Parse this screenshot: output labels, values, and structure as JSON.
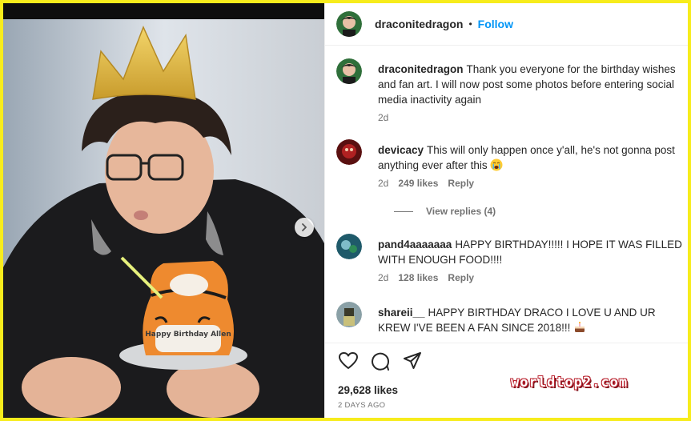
{
  "header": {
    "username": "draconitedragon",
    "separator": "•",
    "follow_label": "Follow"
  },
  "caption": {
    "username": "draconitedragon",
    "text": "Thank you everyone for the birthday wishes and fan art. I will now post some photos before entering social media inactivity again",
    "time": "2d"
  },
  "comments": [
    {
      "username": "devicacy",
      "text": "This will only happen once y'all, he's not gonna post anything ever after this",
      "emoji": "crying-face",
      "time": "2d",
      "likes": "249 likes",
      "reply_label": "Reply",
      "view_replies": "View replies (4)"
    },
    {
      "username": "pand4aaaaaaa",
      "text": "HAPPY BIRTHDAY!!!!! I HOPE IT WAS FILLED WITH ENOUGH FOOD!!!!",
      "time": "2d",
      "likes": "128 likes",
      "reply_label": "Reply"
    },
    {
      "username": "shareii__",
      "text": "HAPPY BIRTHDAY DRACO I LOVE U AND UR KREW I'VE BEEN A FAN SINCE 2018!!!",
      "emoji": "cake"
    }
  ],
  "photo": {
    "cake_text": "Happy Birthday Allen"
  },
  "footer": {
    "likes": "29,628 likes",
    "time": "2 DAYS AGO"
  },
  "watermark": "worldtop2.com",
  "icons": {
    "like": "heart-icon",
    "comment": "comment-icon",
    "share": "send-icon",
    "carousel": "chevron-right-icon"
  },
  "colors": {
    "follow": "#0095f6",
    "secondary_text": "#737373",
    "border_frame": "#f7ec1c"
  }
}
